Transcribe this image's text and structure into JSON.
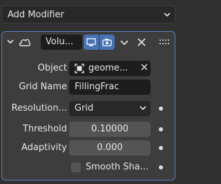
{
  "add_modifier": {
    "label": "Add Modifier"
  },
  "modifier": {
    "name": "Volu...",
    "fields": {
      "object": {
        "label": "Object",
        "value": "geome..."
      },
      "grid_name": {
        "label": "Grid Name",
        "value": "FillingFrac"
      },
      "resolution": {
        "label": "Resolution...",
        "value": "Grid"
      },
      "threshold": {
        "label": "Threshold",
        "value": "0.10000"
      },
      "adaptivity": {
        "label": "Adaptivity",
        "value": "0.000"
      },
      "smooth_shade": {
        "label": "Smooth Sha...",
        "checked": false
      }
    }
  },
  "colors": {
    "accent": "#4772b3",
    "panel_border": "#5680c2"
  }
}
